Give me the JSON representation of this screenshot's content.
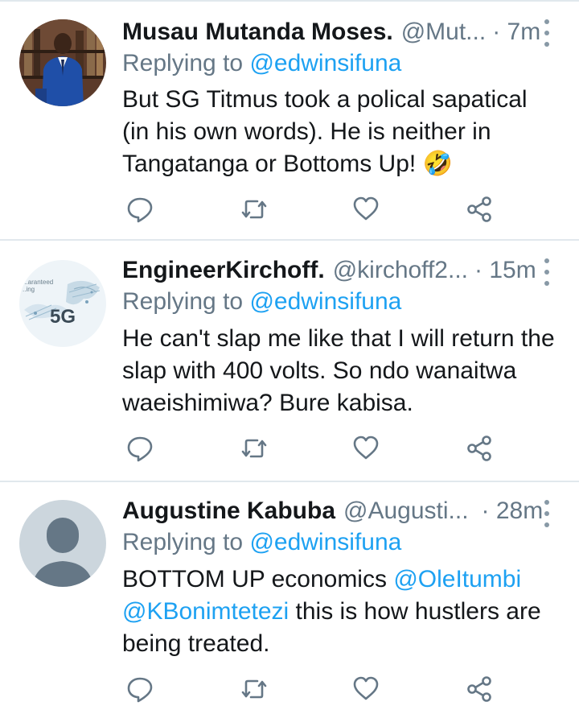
{
  "tweets": [
    {
      "name": "Musau Mutanda Moses.",
      "handle": "@Mut...",
      "time": "· 7m",
      "replying_prefix": "Replying to ",
      "replying_to": "@edwinsifuna",
      "text": "But SG Titmus took a polical sapatical (in his own words). He is neither in Tangatanga or Bottoms Up!",
      "emoji": "🤣",
      "avatar_icon": "profile-photo-man-in-blue-suit"
    },
    {
      "name": "EngineerKirchoff.",
      "handle": "@kirchoff2...",
      "time": "· 15m",
      "replying_prefix": "Replying to ",
      "replying_to": "@edwinsifuna",
      "text": "He can't slap me like that I will return the slap with 400 volts. So ndo wanaitwa waeishimiwa? Bure kabisa.",
      "avatar_icon": "profile-photo-5g-graphic",
      "avatar_text": "5G",
      "avatar_small_text": [
        "...aranteed",
        "..ing"
      ]
    },
    {
      "name": "Augustine Kabuba",
      "handle": "@Augusti...",
      "time": "· 28m",
      "replying_prefix": "Replying to ",
      "replying_to": "@edwinsifuna",
      "text_parts": [
        "BOTTOM UP economics ",
        "@OleItumbi",
        "@KBonimtetezi",
        " this is how hustlers are being treated."
      ],
      "avatar_icon": "default-avatar-silhouette"
    }
  ],
  "actions": [
    "reply-icon",
    "retweet-icon",
    "like-icon",
    "share-icon"
  ],
  "colors": {
    "accent": "#1da1f2",
    "muted": "#657786",
    "text": "#14171a",
    "divider": "#e1e8ed",
    "icon": "#657786"
  }
}
